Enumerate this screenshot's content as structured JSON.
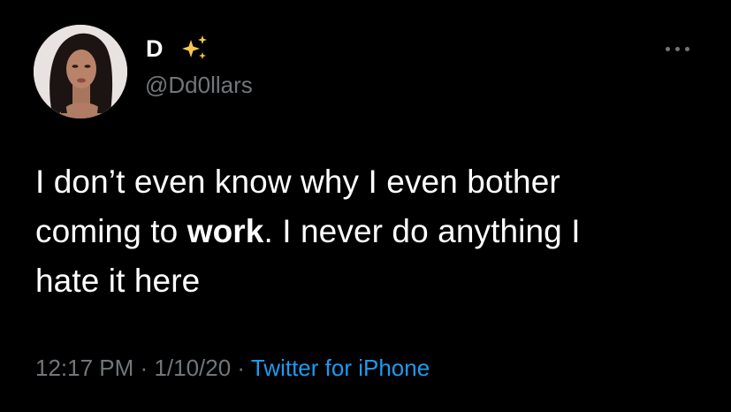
{
  "author": {
    "display_name": "D",
    "emoji_icon": "sparkles-icon",
    "handle": "@Dd0llars"
  },
  "tweet": {
    "line1": "I don’t even know why I even bother",
    "line2_prefix": "coming to ",
    "line2_bold": "work",
    "line2_suffix": ". I never do anything I",
    "line3": "hate it here"
  },
  "meta": {
    "time": "12:17 PM",
    "separator": "·",
    "date": "1/10/20",
    "source": "Twitter for iPhone"
  },
  "colors": {
    "background": "#000000",
    "text": "#ffffff",
    "secondary": "#71767b",
    "link": "#1d9bf0",
    "sparkle": "#f7c948"
  }
}
